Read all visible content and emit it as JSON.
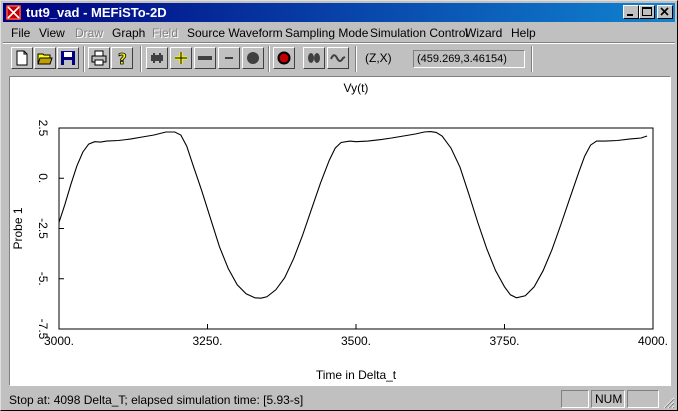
{
  "window": {
    "title": "tut9_vad - MEFiSTo-2D"
  },
  "menu": [
    {
      "label": "File",
      "enabled": true
    },
    {
      "label": "View",
      "enabled": true
    },
    {
      "label": "Draw",
      "enabled": false
    },
    {
      "label": "Graph",
      "enabled": true
    },
    {
      "label": "Field",
      "enabled": false
    },
    {
      "label": "Source Waveform",
      "enabled": true
    },
    {
      "label": "Sampling Mode",
      "enabled": true
    },
    {
      "label": "Simulation Control",
      "enabled": true
    },
    {
      "label": "Wizard",
      "enabled": true
    },
    {
      "label": "Help",
      "enabled": true
    }
  ],
  "toolbar": {
    "coord_label": "(Z,X)",
    "coord_value": "(459.269,3.46154)"
  },
  "chart_data": {
    "type": "line",
    "title": "Vy(t)",
    "xlabel": "Time in Delta_t",
    "ylabel": "Probe 1",
    "xlim": [
      3000,
      4000
    ],
    "ylim": [
      -7.5,
      2.5
    ],
    "xticks": [
      "3000.",
      "3250.",
      "3500.",
      "3750.",
      "4000."
    ],
    "xtick_values": [
      3000,
      3250,
      3500,
      3750,
      4000
    ],
    "yticks": [
      "2.5",
      "0.",
      "-2.5",
      "-5.",
      "-7.5"
    ],
    "ytick_values": [
      2.5,
      0,
      -2.5,
      -5,
      -7.5
    ],
    "series": [
      {
        "color": "#000000",
        "x": [
          3000,
          3010,
          3020,
          3030,
          3040,
          3050,
          3060,
          3070,
          3080,
          3100,
          3120,
          3140,
          3160,
          3180,
          3195,
          3205,
          3215,
          3225,
          3240,
          3255,
          3270,
          3285,
          3300,
          3315,
          3330,
          3340,
          3350,
          3365,
          3380,
          3395,
          3410,
          3425,
          3440,
          3455,
          3465,
          3475,
          3490,
          3500,
          3520,
          3540,
          3560,
          3580,
          3600,
          3615,
          3625,
          3635,
          3645,
          3660,
          3675,
          3690,
          3705,
          3720,
          3735,
          3750,
          3760,
          3770,
          3785,
          3800,
          3815,
          3830,
          3845,
          3860,
          3875,
          3885,
          3895,
          3905,
          3920,
          3940,
          3960,
          3980,
          3990
        ],
        "y": [
          -2.2,
          -1.3,
          -0.3,
          0.6,
          1.3,
          1.7,
          1.82,
          1.8,
          1.85,
          1.88,
          1.95,
          2.05,
          2.15,
          2.3,
          2.3,
          2.15,
          1.6,
          0.7,
          -0.6,
          -2.0,
          -3.4,
          -4.5,
          -5.3,
          -5.75,
          -5.95,
          -5.97,
          -5.9,
          -5.55,
          -4.95,
          -4.0,
          -2.85,
          -1.55,
          -0.25,
          0.9,
          1.5,
          1.78,
          1.85,
          1.82,
          1.85,
          1.92,
          2.0,
          2.1,
          2.2,
          2.3,
          2.32,
          2.28,
          2.1,
          1.5,
          0.55,
          -0.8,
          -2.2,
          -3.5,
          -4.6,
          -5.4,
          -5.8,
          -5.95,
          -5.85,
          -5.4,
          -4.6,
          -3.55,
          -2.3,
          -1.0,
          0.3,
          1.1,
          1.65,
          1.85,
          1.85,
          1.88,
          1.95,
          2.0,
          2.1
        ]
      }
    ]
  },
  "status": {
    "text": "Stop at: 4098 Delta_T;   elapsed simulation time: [5.93-s]",
    "num": "NUM"
  }
}
